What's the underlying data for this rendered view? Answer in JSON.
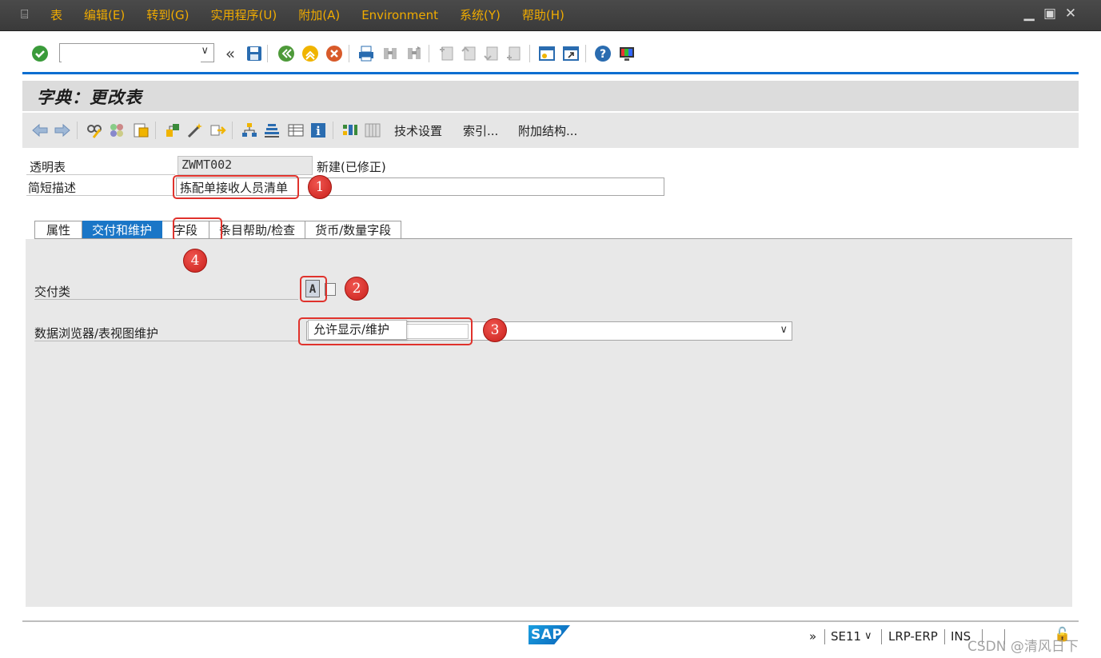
{
  "menu": {
    "items": [
      "表",
      "编辑(E)",
      "转到(G)",
      "实用程序(U)",
      "附加(A)",
      "Environment",
      "系统(Y)",
      "帮助(H)"
    ]
  },
  "std_toolbar": {
    "command_field_value": "",
    "icons": [
      "enter-check-icon",
      "save-icon",
      "back-icon",
      "exit-icon",
      "cancel-icon",
      "print-icon",
      "find-icon",
      "find-next-icon",
      "first-page-icon",
      "previous-page-icon",
      "next-page-icon",
      "last-page-icon",
      "new-session-icon",
      "shortcut-icon",
      "help-icon",
      "layout-menu-icon"
    ]
  },
  "title": "字典：更改表",
  "app_toolbar": {
    "text_buttons": [
      "技术设置",
      "索引...",
      "附加结构..."
    ]
  },
  "header": {
    "table_type_label": "透明表",
    "table_name": "ZWMT002",
    "table_status": "新建(已修正)",
    "short_desc_label": "简短描述",
    "short_desc_value": "拣配单接收人员清单"
  },
  "tabs": {
    "items": [
      "属性",
      "交付和维护",
      "字段",
      "条目帮助/检查",
      "货币/数量字段"
    ],
    "active_index": 1
  },
  "panel": {
    "delivery_class_label": "交付类",
    "delivery_class_value": "A",
    "browser_label": "数据浏览器/表视图维护",
    "browser_value": "允许显示/维护"
  },
  "annotations": [
    "1",
    "2",
    "3",
    "4"
  ],
  "status_bar": {
    "logo": "SAP",
    "arrow": "»",
    "transaction": "SE11",
    "system": "LRP-ERP",
    "mode": "INS",
    "watermark": "CSDN @清风日下"
  },
  "colors": {
    "menu_text": "#f0ab00",
    "active_tab": "#1a76c7",
    "annotation_red": "#e0322c",
    "toolbar_accent": "#0a6ed1"
  }
}
